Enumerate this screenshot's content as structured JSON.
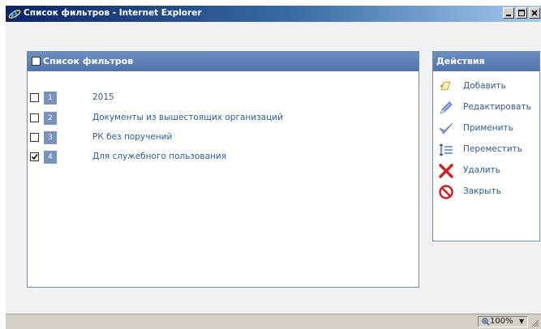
{
  "window": {
    "title": "Список фильтров - Internet Explorer",
    "controls": [
      "minimize",
      "maximize",
      "close"
    ]
  },
  "filters_panel": {
    "title": "Список фильтров",
    "items": [
      {
        "number": "1",
        "label": "2015",
        "checked": false
      },
      {
        "number": "2",
        "label": "Документы из вышестоящих организаций",
        "checked": false
      },
      {
        "number": "3",
        "label": "РК без поручений",
        "checked": false
      },
      {
        "number": "4",
        "label": "Для служебного пользования",
        "checked": true
      }
    ]
  },
  "actions_panel": {
    "title": "Действия",
    "items": [
      {
        "label": "Добавить",
        "icon": "add-icon"
      },
      {
        "label": "Редактировать",
        "icon": "pencil-icon"
      },
      {
        "label": "Применить",
        "icon": "checkmark-icon"
      },
      {
        "label": "Переместить",
        "icon": "move-icon"
      },
      {
        "label": "Удалить",
        "icon": "delete-icon"
      },
      {
        "label": "Закрыть",
        "icon": "close-circle-icon"
      }
    ]
  },
  "statusbar": {
    "zoom": "100%"
  },
  "colors": {
    "header": "#5a7db5",
    "link_text": "#2b5b9a",
    "number_badge": "#7891bd"
  }
}
